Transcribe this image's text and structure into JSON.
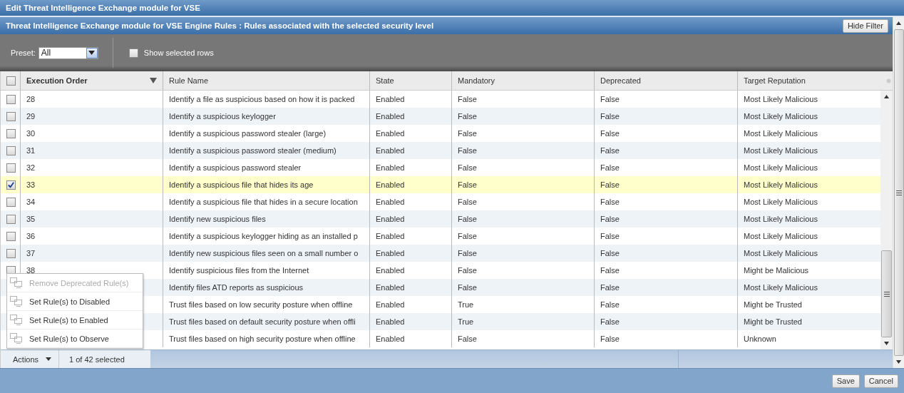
{
  "window": {
    "title": "Edit Threat Intelligence Exchange module for VSE"
  },
  "panel": {
    "title": "Threat Intelligence Exchange module for VSE Engine Rules : Rules associated with the selected security level",
    "hide_filter_button": "Hide Filter"
  },
  "filter": {
    "preset_label": "Preset:",
    "preset_value": "All",
    "show_selected": {
      "label": "Show selected rows",
      "checked": false
    }
  },
  "table": {
    "select_all_checked": false,
    "columns": [
      {
        "label": "Execution Order",
        "sorted": true
      },
      {
        "label": "Rule Name",
        "sorted": false
      },
      {
        "label": "State",
        "sorted": false
      },
      {
        "label": "Mandatory",
        "sorted": false
      },
      {
        "label": "Deprecated",
        "sorted": false
      },
      {
        "label": "Target Reputation",
        "sorted": false
      }
    ],
    "rows": [
      {
        "checked": false,
        "order": "28",
        "rule": "Identify a file as suspicious based on how it is packed",
        "state": "Enabled",
        "mandatory": "False",
        "deprecated": "False",
        "reputation": "Most Likely Malicious"
      },
      {
        "checked": false,
        "order": "29",
        "rule": "Identify a suspicious keylogger",
        "state": "Enabled",
        "mandatory": "False",
        "deprecated": "False",
        "reputation": "Most Likely Malicious"
      },
      {
        "checked": false,
        "order": "30",
        "rule": "Identify a suspicious password stealer (large)",
        "state": "Enabled",
        "mandatory": "False",
        "deprecated": "False",
        "reputation": "Most Likely Malicious"
      },
      {
        "checked": false,
        "order": "31",
        "rule": "Identify a suspicious password stealer (medium)",
        "state": "Enabled",
        "mandatory": "False",
        "deprecated": "False",
        "reputation": "Most Likely Malicious"
      },
      {
        "checked": false,
        "order": "32",
        "rule": "Identify a suspicious password stealer",
        "state": "Enabled",
        "mandatory": "False",
        "deprecated": "False",
        "reputation": "Most Likely Malicious"
      },
      {
        "checked": true,
        "order": "33",
        "rule": "Identify a suspicious file that hides its age",
        "state": "Enabled",
        "mandatory": "False",
        "deprecated": "False",
        "reputation": "Most Likely Malicious"
      },
      {
        "checked": false,
        "order": "34",
        "rule": "Identify a suspicious file that hides in a secure location",
        "state": "Enabled",
        "mandatory": "False",
        "deprecated": "False",
        "reputation": "Most Likely Malicious"
      },
      {
        "checked": false,
        "order": "35",
        "rule": "Identify new suspicious files",
        "state": "Enabled",
        "mandatory": "False",
        "deprecated": "False",
        "reputation": "Most Likely Malicious"
      },
      {
        "checked": false,
        "order": "36",
        "rule": "Identify a suspicious keylogger hiding as an installed p",
        "state": "Enabled",
        "mandatory": "False",
        "deprecated": "False",
        "reputation": "Most Likely Malicious"
      },
      {
        "checked": false,
        "order": "37",
        "rule": "Identify new suspicious files seen on a small number o",
        "state": "Enabled",
        "mandatory": "False",
        "deprecated": "False",
        "reputation": "Most Likely Malicious"
      },
      {
        "checked": false,
        "order": "38",
        "rule": "Identify suspicious files from the Internet",
        "state": "Enabled",
        "mandatory": "False",
        "deprecated": "False",
        "reputation": "Might be Malicious"
      },
      {
        "rule": "Identify files ATD reports as suspicious",
        "state": "Enabled",
        "mandatory": "False",
        "deprecated": "False",
        "reputation": "Most Likely Malicious"
      },
      {
        "rule": "Trust files based on low security posture when offline",
        "state": "Enabled",
        "mandatory": "True",
        "deprecated": "False",
        "reputation": "Might be Trusted"
      },
      {
        "rule": "Trust files based on default security posture when offli",
        "state": "Enabled",
        "mandatory": "True",
        "deprecated": "False",
        "reputation": "Might be Trusted"
      },
      {
        "rule": "Trust files based on high security posture when offline",
        "state": "Enabled",
        "mandatory": "False",
        "deprecated": "False",
        "reputation": "Unknown"
      }
    ]
  },
  "actions_menu": {
    "items": [
      {
        "label": "Remove Deprecated Rule(s)",
        "disabled": true
      },
      {
        "label": "Set Rule(s) to Disabled",
        "disabled": false
      },
      {
        "label": "Set Rule(s) to Enabled",
        "disabled": false
      },
      {
        "label": "Set Rule(s) to Observe",
        "disabled": false
      }
    ]
  },
  "footer": {
    "actions_button": "Actions",
    "selection_count": "1 of 42 selected"
  },
  "buttons": [
    "Save",
    "Cancel"
  ]
}
